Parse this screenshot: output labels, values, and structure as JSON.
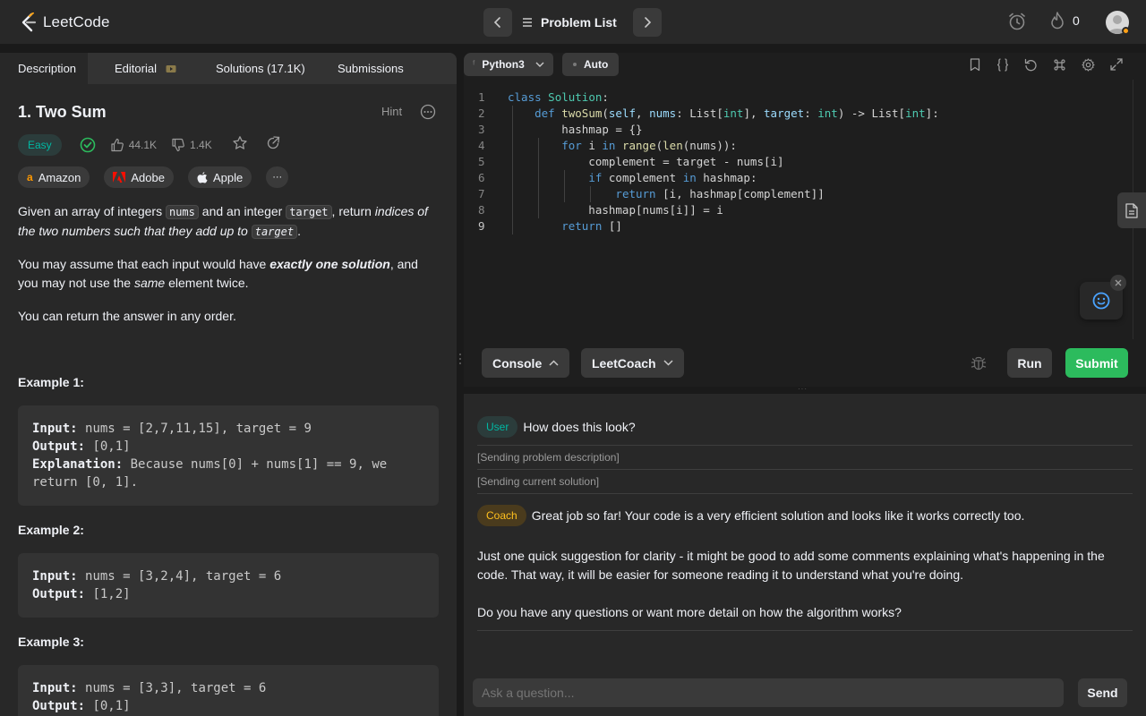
{
  "brand": {
    "name": "LeetCode",
    "accent": "#ffa116"
  },
  "header": {
    "problem_list_label": "Problem List",
    "streak_count": "0",
    "icons": [
      "prev-chevron-icon",
      "list-icon",
      "next-chevron-icon",
      "alarm-icon",
      "fire-icon",
      "avatar"
    ]
  },
  "tabs": [
    {
      "label": "Description",
      "active": true
    },
    {
      "label": "Editorial",
      "active": false
    },
    {
      "label": "Solutions (17.1K)",
      "active": false
    },
    {
      "label": "Submissions",
      "active": false
    }
  ],
  "problem": {
    "title": "1. Two Sum",
    "hint_label": "Hint",
    "difficulty": "Easy",
    "likes": "44.1K",
    "dislikes": "1.4K",
    "companies": [
      "Amazon",
      "Adobe",
      "Apple"
    ],
    "more_companies": "···",
    "desc1": {
      "pre": "Given an array of integers ",
      "code1": "nums",
      "mid": " and an integer ",
      "code2": "target",
      "mid2": ", return ",
      "em": "indices of the two numbers such that they add up to",
      "code3": "target",
      "end": "."
    },
    "desc2": {
      "pre": "You may assume that each input would have ",
      "strong": "exactly one solution",
      "mid": ", and you may not use the ",
      "em": "same",
      "end": " element twice."
    },
    "desc3": "You can return the answer in any order.",
    "examples": [
      {
        "title": "Example 1:",
        "input_label": "Input:",
        "input": "nums = [2,7,11,15], target = 9",
        "output_label": "Output:",
        "output": "[0,1]",
        "explanation_label": "Explanation:",
        "explanation": "Because nums[0] + nums[1] == 9, we return [0, 1]."
      },
      {
        "title": "Example 2:",
        "input_label": "Input:",
        "input": "nums = [3,2,4], target = 6",
        "output_label": "Output:",
        "output": "[1,2]"
      },
      {
        "title": "Example 3:",
        "input_label": "Input:",
        "input": "nums = [3,3], target = 6",
        "output_label": "Output:",
        "output": "[0,1]"
      }
    ]
  },
  "editor": {
    "language": "Python3",
    "mode": "Auto",
    "line_numbers": [
      "1",
      "2",
      "3",
      "4",
      "5",
      "6",
      "7",
      "8",
      "9"
    ],
    "code_lines": [
      "class Solution:",
      "    def twoSum(self, nums: List[int], target: int) -> List[int]:",
      "        hashmap = {}",
      "        for i in range(len(nums)):",
      "            complement = target - nums[i]",
      "            if complement in hashmap:",
      "                return [i, hashmap[complement]]",
      "            hashmap[nums[i]] = i",
      "        return []"
    ],
    "console_label": "Console",
    "coach_label": "LeetCoach",
    "run_label": "Run",
    "submit_label": "Submit"
  },
  "chat": {
    "user_role": "User",
    "user_message": "How does this look?",
    "system_1": "[Sending problem description]",
    "system_2": "[Sending current solution]",
    "coach_role": "Coach",
    "coach_p1": "Great job so far! Your code is a very efficient solution and looks like it works correctly too.",
    "coach_p2": "Just one quick suggestion for clarity - it might be good to add some comments explaining what's happening in the code. That way, it will be easier for someone reading it to understand what you're doing.",
    "coach_p3": "Do you have any questions or want more detail on how the algorithm works?",
    "input_placeholder": "Ask a question...",
    "send_label": "Send"
  }
}
